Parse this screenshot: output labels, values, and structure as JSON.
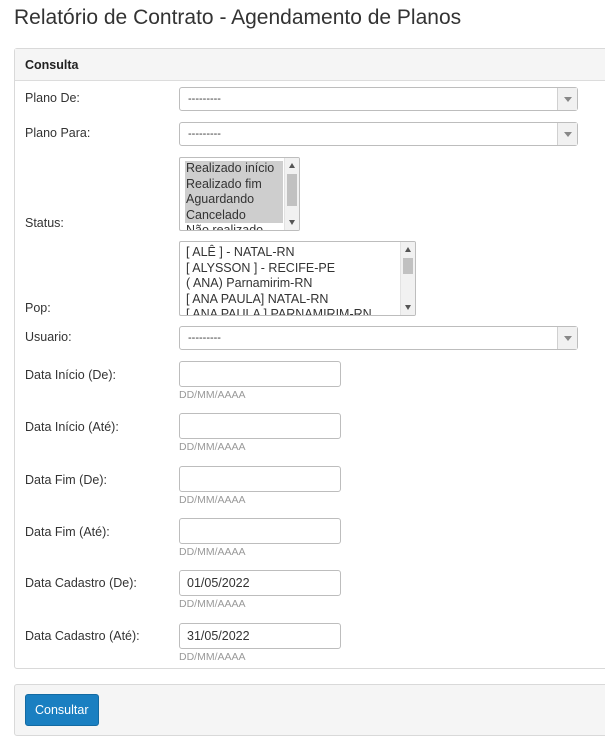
{
  "page": {
    "title": "Relatório de Contrato - Agendamento de Planos"
  },
  "panel": {
    "heading": "Consulta"
  },
  "fields": {
    "plano_de": {
      "label": "Plano De:",
      "value": "---------"
    },
    "plano_para": {
      "label": "Plano Para:",
      "value": "---------"
    },
    "status": {
      "label": "Status:",
      "options": [
        {
          "text": "Realizado início",
          "selected": true
        },
        {
          "text": "Realizado fim",
          "selected": true
        },
        {
          "text": "Aguardando",
          "selected": true
        },
        {
          "text": "Cancelado",
          "selected": true
        },
        {
          "text": "Não realizado",
          "selected": false
        }
      ]
    },
    "pop": {
      "label": "Pop:",
      "options": [
        {
          "text": "[ ALÊ ] - NATAL-RN",
          "selected": false
        },
        {
          "text": "[ ALYSSON ] - RECIFE-PE",
          "selected": false
        },
        {
          "text": "( ANA) Parnamirim-RN",
          "selected": false
        },
        {
          "text": "[ ANA PAULA] NATAL-RN",
          "selected": false
        },
        {
          "text": "[ ANA PAULA ] PARNAMIRIM-RN",
          "selected": false
        }
      ]
    },
    "usuario": {
      "label": "Usuario:",
      "value": "---------"
    },
    "data_inicio_de": {
      "label": "Data Início (De):",
      "value": "",
      "hint": "DD/MM/AAAA"
    },
    "data_inicio_ate": {
      "label": "Data Início (Até):",
      "value": "",
      "hint": "DD/MM/AAAA"
    },
    "data_fim_de": {
      "label": "Data Fim (De):",
      "value": "",
      "hint": "DD/MM/AAAA"
    },
    "data_fim_ate": {
      "label": "Data Fim (Até):",
      "value": "",
      "hint": "DD/MM/AAAA"
    },
    "data_cadastro_de": {
      "label": "Data Cadastro (De):",
      "value": "01/05/2022",
      "hint": "DD/MM/AAAA"
    },
    "data_cadastro_ate": {
      "label": "Data Cadastro (Até):",
      "value": "31/05/2022",
      "hint": "DD/MM/AAAA"
    }
  },
  "actions": {
    "submit_label": "Consultar"
  },
  "colors": {
    "primary_button": "#1a7fc1",
    "selected_option": "#cecece"
  },
  "icons": {
    "select_arrow": "chevron-down-icon",
    "scroll_up": "scroll-up-icon",
    "scroll_down": "scroll-down-icon"
  }
}
